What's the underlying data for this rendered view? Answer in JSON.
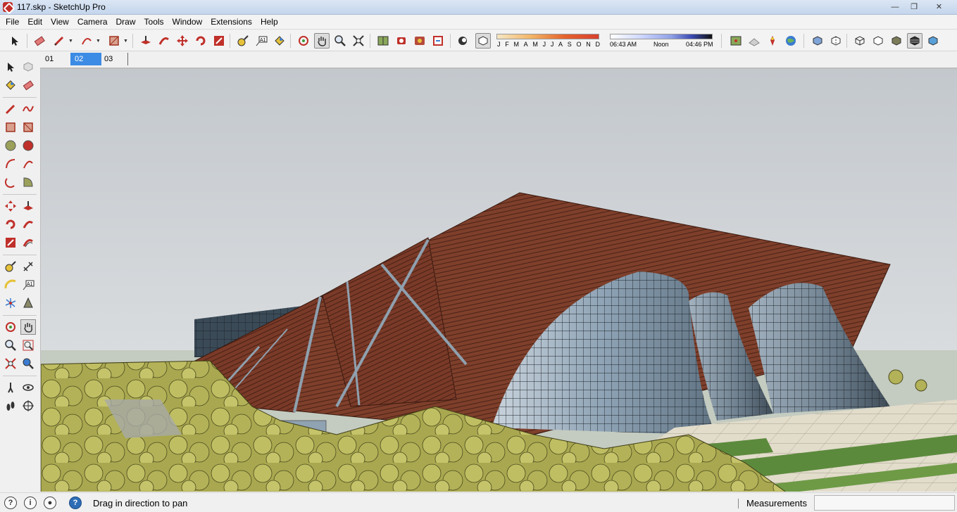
{
  "window": {
    "title": "117.skp - SketchUp Pro"
  },
  "menu": [
    "File",
    "Edit",
    "View",
    "Camera",
    "Draw",
    "Tools",
    "Window",
    "Extensions",
    "Help"
  ],
  "shadows": {
    "months": [
      "J",
      "F",
      "M",
      "A",
      "M",
      "J",
      "J",
      "A",
      "S",
      "O",
      "N",
      "D"
    ],
    "time_start": "06:43 AM",
    "time_mid": "Noon",
    "time_end": "04:46 PM"
  },
  "scenes": {
    "tabs": [
      "01",
      "02",
      "03"
    ],
    "active": "02"
  },
  "status": {
    "message": "Drag in direction to pan",
    "measurements_label": "Measurements",
    "measurements_value": ""
  },
  "colors": {
    "sky": "#c9cdd1",
    "roof": "#7e3f2b",
    "glass": "#95a8b8",
    "tree": "#b6b45a",
    "accent": "#3c8be4"
  },
  "icons": {
    "top": [
      "select",
      "eraser",
      "pencil",
      "arc",
      "rectangle",
      "push-pull",
      "follow-me",
      "move",
      "rotate",
      "scale",
      "tape-measure",
      "text",
      "paint-bucket",
      "orbit",
      "pan",
      "zoom",
      "zoom-extents",
      "warehouse",
      "components",
      "extension-warehouse",
      "layout",
      "shadows",
      "fog"
    ],
    "styles": [
      "xray",
      "back-edges",
      "wireframe",
      "hidden-line",
      "shaded",
      "shaded-textures",
      "monochrome"
    ]
  }
}
